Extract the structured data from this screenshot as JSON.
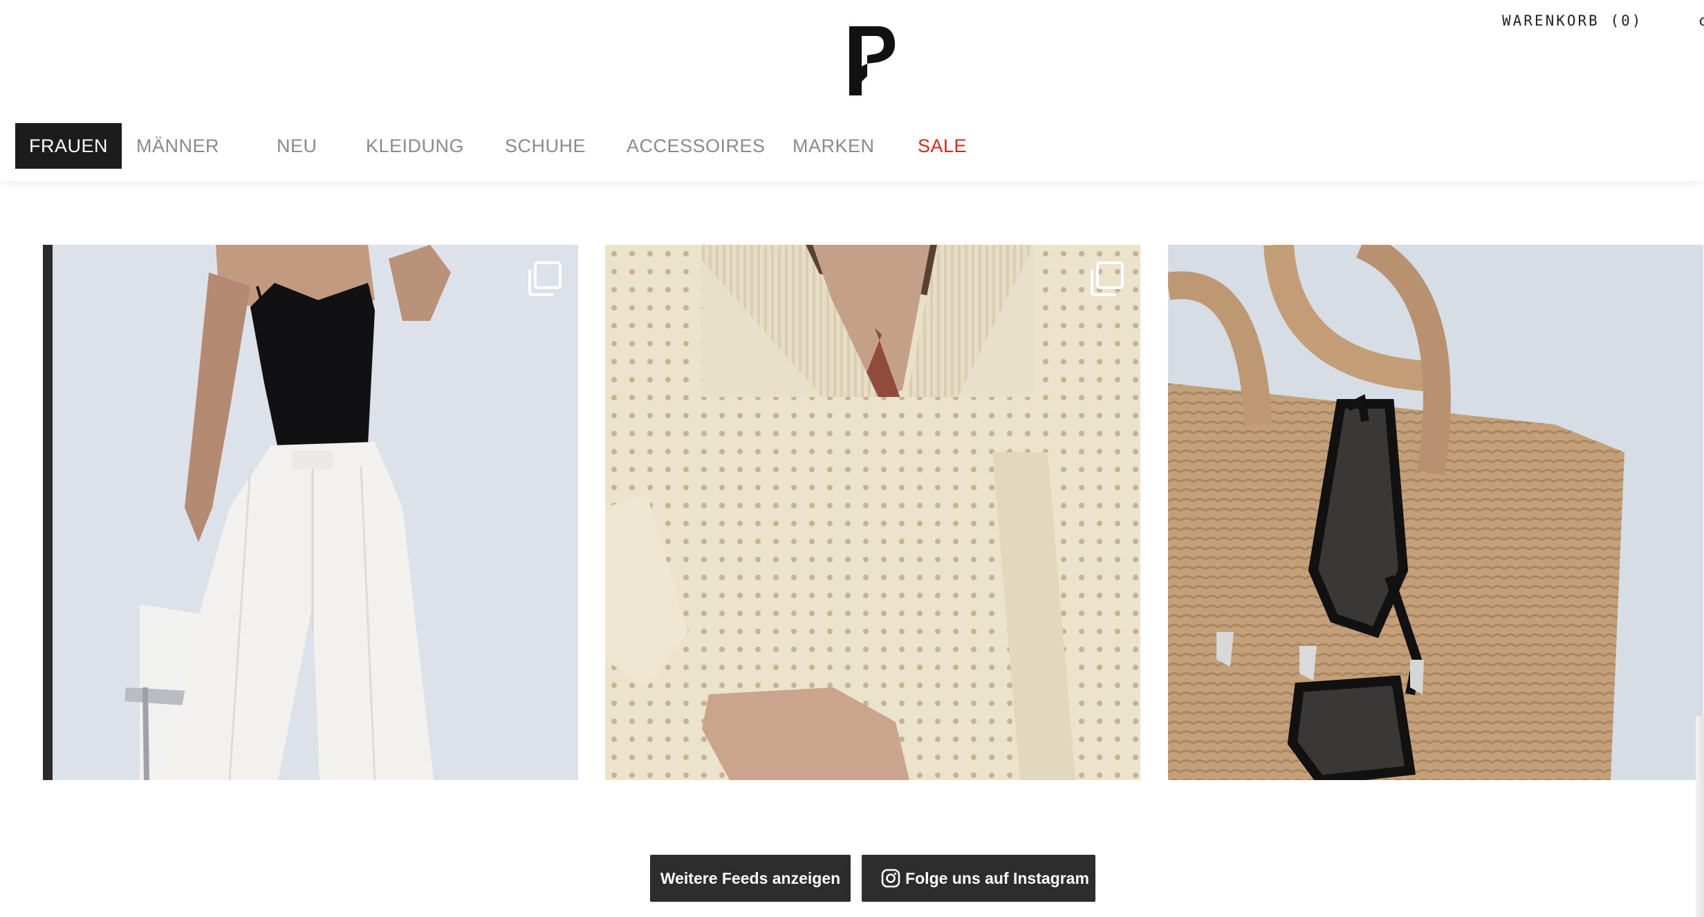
{
  "header": {
    "logo_icon": "p-logo-icon",
    "cart_label": "WARENKORB",
    "cart_count": "0",
    "edge_glyph": "c"
  },
  "nav": {
    "items": [
      {
        "label": "FRAUEN",
        "active": true
      },
      {
        "label": "MÄNNER"
      },
      {
        "label": "NEU"
      },
      {
        "label": "KLEIDUNG"
      },
      {
        "label": "SCHUHE"
      },
      {
        "label": "ACCESSOIRES"
      },
      {
        "label": "MARKEN"
      },
      {
        "label": "SALE",
        "accent": "#d4271e"
      }
    ]
  },
  "feed": {
    "tiles": [
      {
        "subject": "white-trousers-black-top",
        "badge_icon": "multiple-images-icon"
      },
      {
        "subject": "cream-knit-sweater",
        "badge_icon": "multiple-images-icon"
      },
      {
        "subject": "raffia-bag-sunglasses"
      }
    ],
    "more_button": "Weitere Feeds anzeigen",
    "follow_button": "Folge uns auf Instagram",
    "follow_icon": "instagram-icon"
  },
  "colors": {
    "nav_active_bg": "#1c1c1c",
    "button_bg": "#2d2d2d",
    "sale": "#d4271e"
  }
}
